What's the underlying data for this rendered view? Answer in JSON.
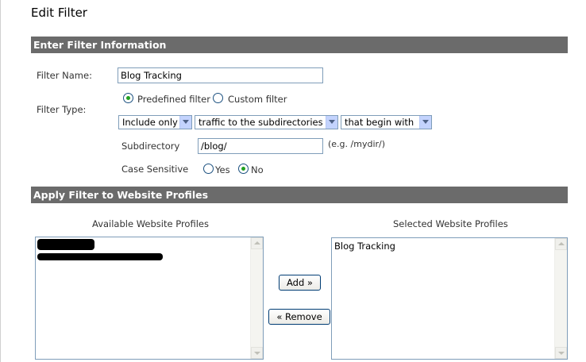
{
  "page": {
    "title": "Edit Filter"
  },
  "filter_info": {
    "section_title": "Enter Filter Information",
    "filter_name_label": "Filter Name:",
    "filter_name_value": "Blog Tracking",
    "filter_type_label": "Filter Type:",
    "predefined_label": "Predefined filter",
    "predefined_checked": true,
    "custom_label": "Custom filter",
    "custom_checked": false,
    "include_select": "Include only",
    "traffic_select": "traffic to the subdirectories",
    "match_select": "that begin with",
    "subdirectory_label": "Subdirectory",
    "subdirectory_value": "/blog/",
    "subdirectory_hint": "(e.g. /mydir/)",
    "case_label": "Case Sensitive",
    "case_yes": "Yes",
    "case_no": "No",
    "case_selected": "No"
  },
  "profiles": {
    "section_title": "Apply Filter to Website Profiles",
    "available_header": "Available Website Profiles",
    "selected_header": "Selected Website Profiles",
    "selected_items": [
      "Blog Tracking"
    ],
    "add_button": "Add »",
    "remove_button": "« Remove"
  },
  "colors": {
    "section_bar": "#6b6b6b",
    "radio_dot": "#21a121",
    "input_border": "#7f9db9"
  }
}
